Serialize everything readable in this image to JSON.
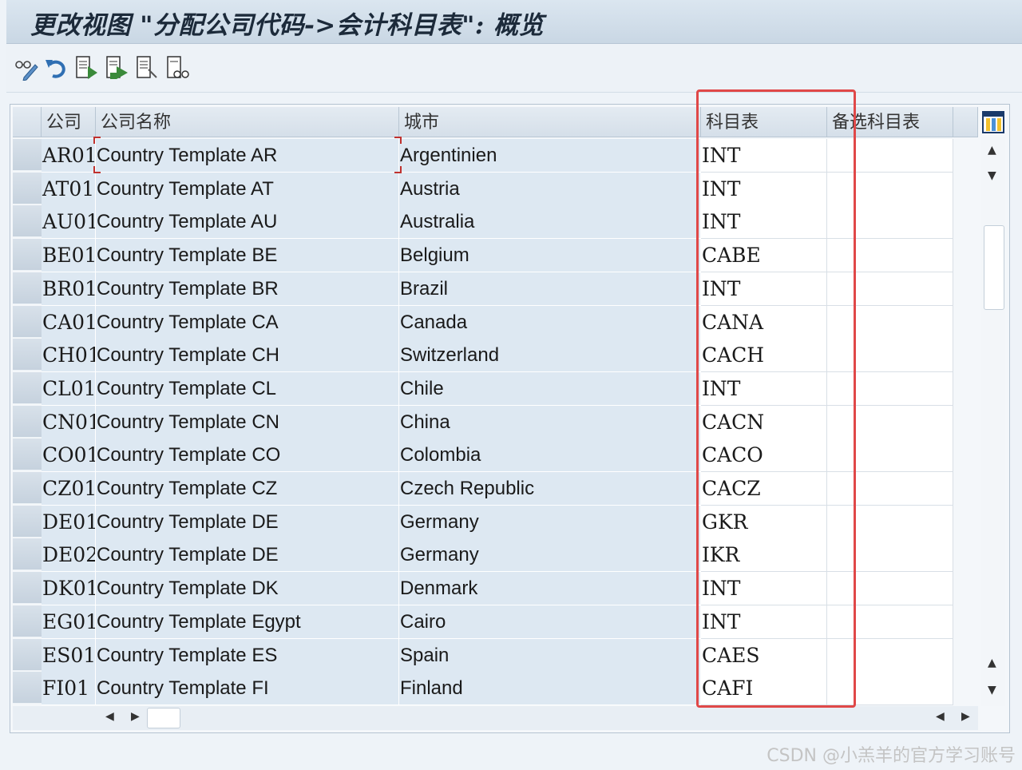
{
  "window": {
    "title": "更改视图 \"分配公司代码->会计科目表\": 概览"
  },
  "toolbar": {
    "icons": [
      "display-change-icon",
      "undo-icon",
      "new-entries-icon",
      "copy-as-icon",
      "delete-icon",
      "select-all-icon"
    ]
  },
  "table": {
    "columns": [
      "公司",
      "公司名称",
      "城市",
      "科目表",
      "备选科目表"
    ],
    "rows": [
      {
        "company": "AR01",
        "name": "Country Template AR",
        "city": "Argentinien",
        "coa": "INT",
        "alt": ""
      },
      {
        "company": "AT01",
        "name": "Country Template AT",
        "city": "Austria",
        "coa": "INT",
        "alt": ""
      },
      {
        "company": "AU01",
        "name": "Country Template AU",
        "city": "Australia",
        "coa": "INT",
        "alt": ""
      },
      {
        "company": "BE01",
        "name": "Country Template BE",
        "city": "Belgium",
        "coa": "CABE",
        "alt": ""
      },
      {
        "company": "BR01",
        "name": "Country Template BR",
        "city": "Brazil",
        "coa": "INT",
        "alt": ""
      },
      {
        "company": "CA01",
        "name": "Country Template CA",
        "city": "Canada",
        "coa": "CANA",
        "alt": ""
      },
      {
        "company": "CH01",
        "name": "Country Template CH",
        "city": "Switzerland",
        "coa": "CACH",
        "alt": ""
      },
      {
        "company": "CL01",
        "name": "Country Template CL",
        "city": "Chile",
        "coa": "INT",
        "alt": ""
      },
      {
        "company": "CN01",
        "name": "Country Template CN",
        "city": "China",
        "coa": "CACN",
        "alt": ""
      },
      {
        "company": "CO01",
        "name": "Country Template CO",
        "city": "Colombia",
        "coa": "CACO",
        "alt": ""
      },
      {
        "company": "CZ01",
        "name": "Country Template CZ",
        "city": "Czech Republic",
        "coa": "CACZ",
        "alt": ""
      },
      {
        "company": "DE01",
        "name": "Country Template DE",
        "city": "Germany",
        "coa": "GKR",
        "alt": ""
      },
      {
        "company": "DE02",
        "name": "Country Template DE",
        "city": "Germany",
        "coa": "IKR",
        "alt": ""
      },
      {
        "company": "DK01",
        "name": "Country Template DK",
        "city": "Denmark",
        "coa": "INT",
        "alt": ""
      },
      {
        "company": "EG01",
        "name": "Country Template Egypt",
        "city": "Cairo",
        "coa": "INT",
        "alt": ""
      },
      {
        "company": "ES01",
        "name": "Country Template ES",
        "city": "Spain",
        "coa": "CAES",
        "alt": ""
      },
      {
        "company": "FI01",
        "name": "Country Template FI",
        "city": "Finland",
        "coa": "CAFI",
        "alt": ""
      }
    ]
  },
  "watermark": "CSDN @小羔羊的官方学习账号",
  "colors": {
    "highlight": "#e04848",
    "cell_bg": "#dde8f2"
  }
}
